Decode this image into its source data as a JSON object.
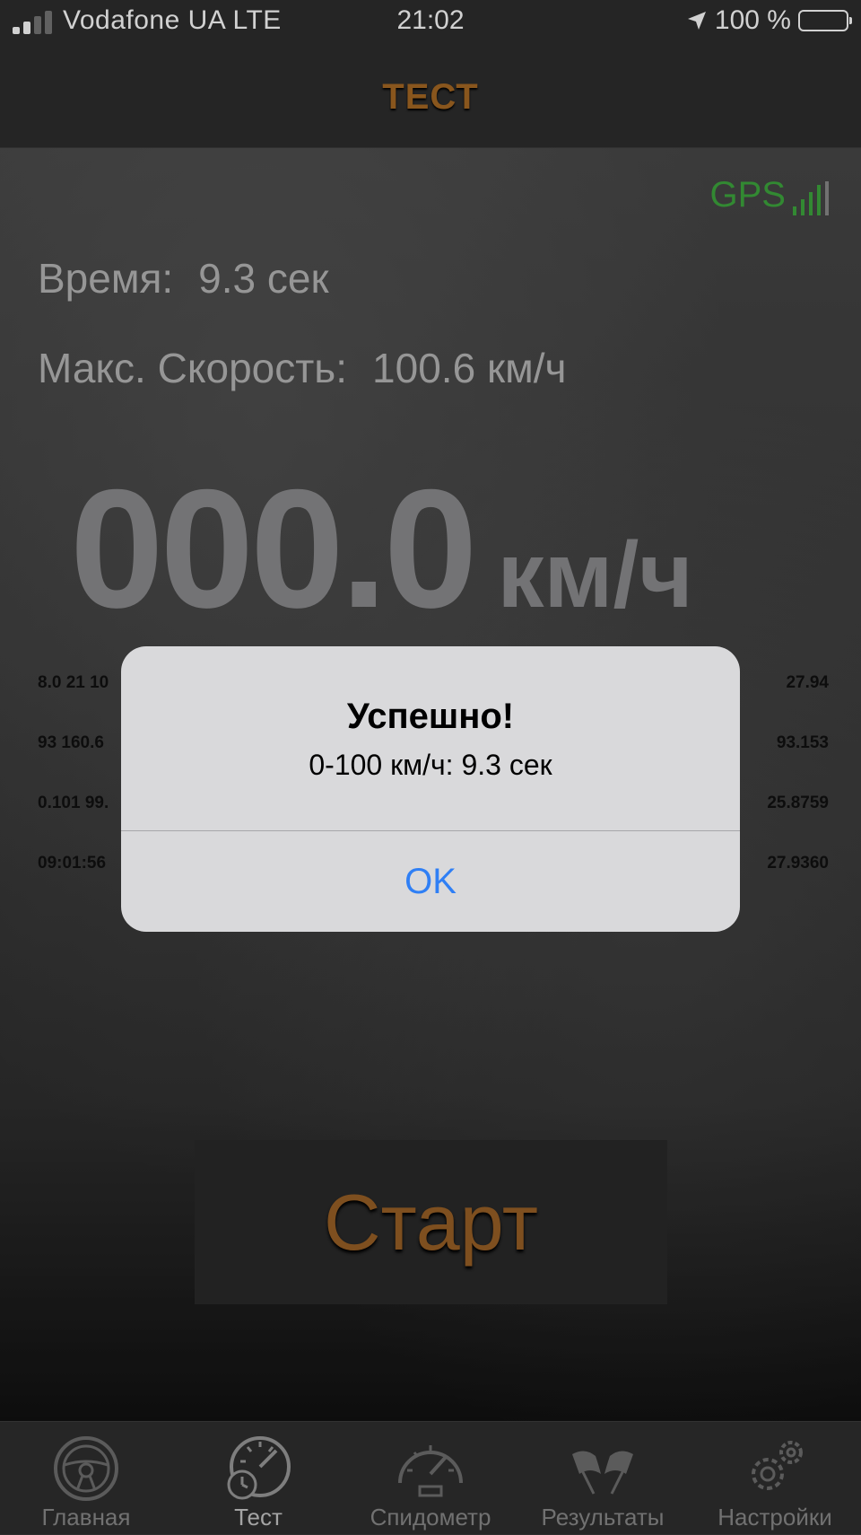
{
  "status_bar": {
    "carrier": "Vodafone UA  LTE",
    "time": "21:02",
    "battery": "100 %"
  },
  "nav": {
    "title": "ТЕСТ"
  },
  "gps": {
    "label": "GPS"
  },
  "stats": {
    "time_label": "Время:",
    "time_value": "9.3 сек",
    "max_speed_label": "Макс. Скорость:",
    "max_speed_value": "100.6 км/ч"
  },
  "speed": {
    "value": "000.0",
    "unit": "км/ч"
  },
  "diagnostics": {
    "left": [
      "8.0 21 10",
      "93 160.6",
      "0.101 99.",
      "09:01:56"
    ],
    "right": [
      "27.94",
      "93.153",
      "25.8759",
      "27.9360"
    ]
  },
  "start_button": {
    "label": "Старт"
  },
  "alert": {
    "title": "Успешно!",
    "message": "0-100 км/ч: 9.3 сек",
    "ok": "OK"
  },
  "tabs": [
    {
      "label": "Главная",
      "icon": "steering-wheel-icon",
      "active": false
    },
    {
      "label": "Тест",
      "icon": "stopwatch-speedometer-icon",
      "active": true
    },
    {
      "label": "Спидометр",
      "icon": "speedometer-icon",
      "active": false
    },
    {
      "label": "Результаты",
      "icon": "flags-icon",
      "active": false
    },
    {
      "label": "Настройки",
      "icon": "gears-icon",
      "active": false
    }
  ],
  "colors": {
    "accent": "#a86a24",
    "gps_green": "#3ea83e",
    "alert_link": "#2f7ff5"
  }
}
